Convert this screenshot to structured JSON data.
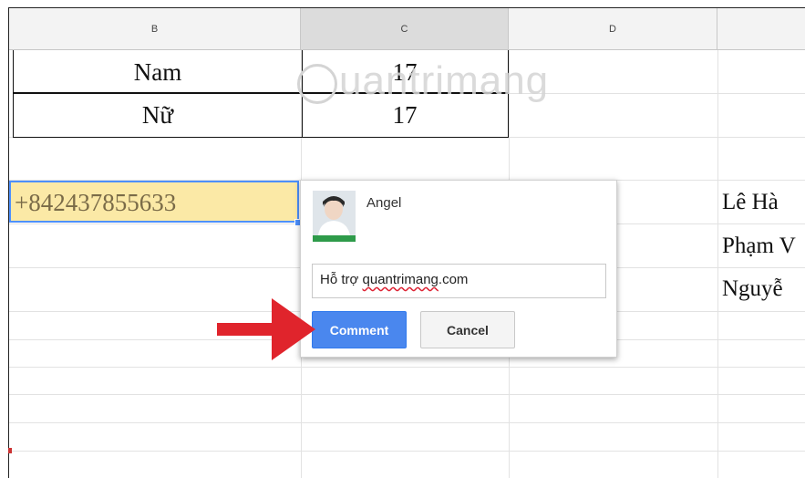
{
  "columns": [
    "B",
    "C",
    "D",
    ""
  ],
  "table": {
    "rows": [
      {
        "label": "Nam",
        "value": "17"
      },
      {
        "label": "Nữ",
        "value": "17"
      }
    ]
  },
  "selected_cell": {
    "value": "+842437855633"
  },
  "right_column": [
    "Lê Hà",
    "Phạm V",
    "Nguyễ"
  ],
  "watermark": {
    "text": "uantrimang"
  },
  "comment_popup": {
    "user_name": "Angel",
    "input_value": "Hỗ trợ quantrimang.com",
    "input_prefix": "Hỗ trợ ",
    "input_link": "quantrimang",
    "input_suffix": ".com",
    "comment_label": "Comment",
    "cancel_label": "Cancel"
  },
  "colors": {
    "selection_fill": "#fbe9a6",
    "selection_border": "#4d90fe",
    "comment_button": "#4a87ee",
    "arrow": "#e0242c"
  }
}
